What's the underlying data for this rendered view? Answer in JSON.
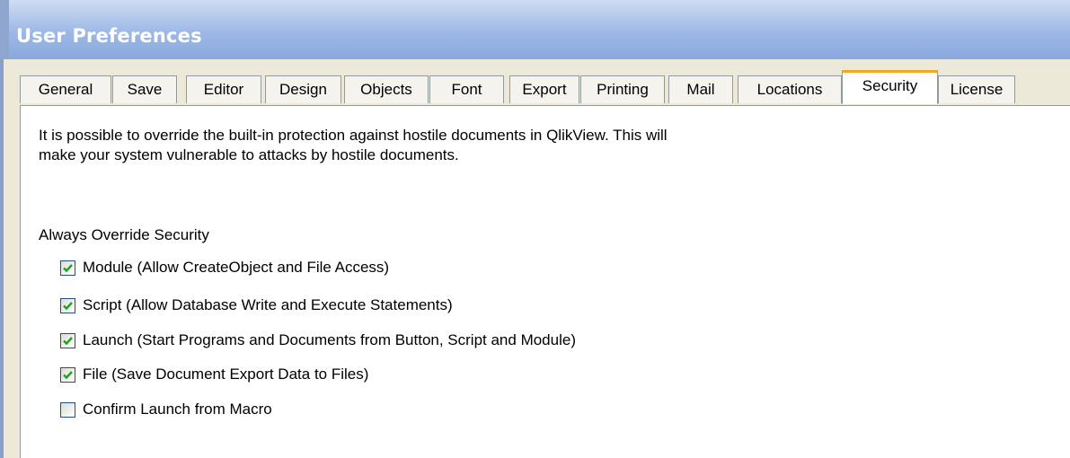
{
  "window": {
    "title": "User Preferences"
  },
  "tabs": [
    {
      "label": "General",
      "active": false
    },
    {
      "label": "Save",
      "active": false
    },
    {
      "label": "Editor",
      "active": false
    },
    {
      "label": "Design",
      "active": false
    },
    {
      "label": "Objects",
      "active": false
    },
    {
      "label": "Font",
      "active": false
    },
    {
      "label": "Export",
      "active": false
    },
    {
      "label": "Printing",
      "active": false
    },
    {
      "label": "Mail",
      "active": false
    },
    {
      "label": "Locations",
      "active": false
    },
    {
      "label": "Security",
      "active": true
    },
    {
      "label": "License",
      "active": false
    }
  ],
  "security": {
    "description_line1": "It is possible to override the built-in protection against hostile documents in QlikView. This will",
    "description_line2": "make your system vulnerable to attacks by hostile documents.",
    "group_label": "Always Override Security",
    "options": [
      {
        "label": "Module (Allow CreateObject and File Access)",
        "checked": true
      },
      {
        "label": "Script (Allow Database Write and Execute Statements)",
        "checked": true
      },
      {
        "label": "Launch (Start Programs and Documents from Button, Script and Module)",
        "checked": true
      },
      {
        "label": "File (Save Document  Export Data to Files)",
        "checked": true
      },
      {
        "label": "Confirm Launch from Macro",
        "checked": false
      }
    ]
  },
  "colors": {
    "tab_active_accent": "#f5a623",
    "checkmark": "#21a121",
    "checkbox_border": "#1c5180",
    "titlebar": "#9db8e6"
  },
  "icons": {
    "checkmark": "checkmark-icon"
  }
}
